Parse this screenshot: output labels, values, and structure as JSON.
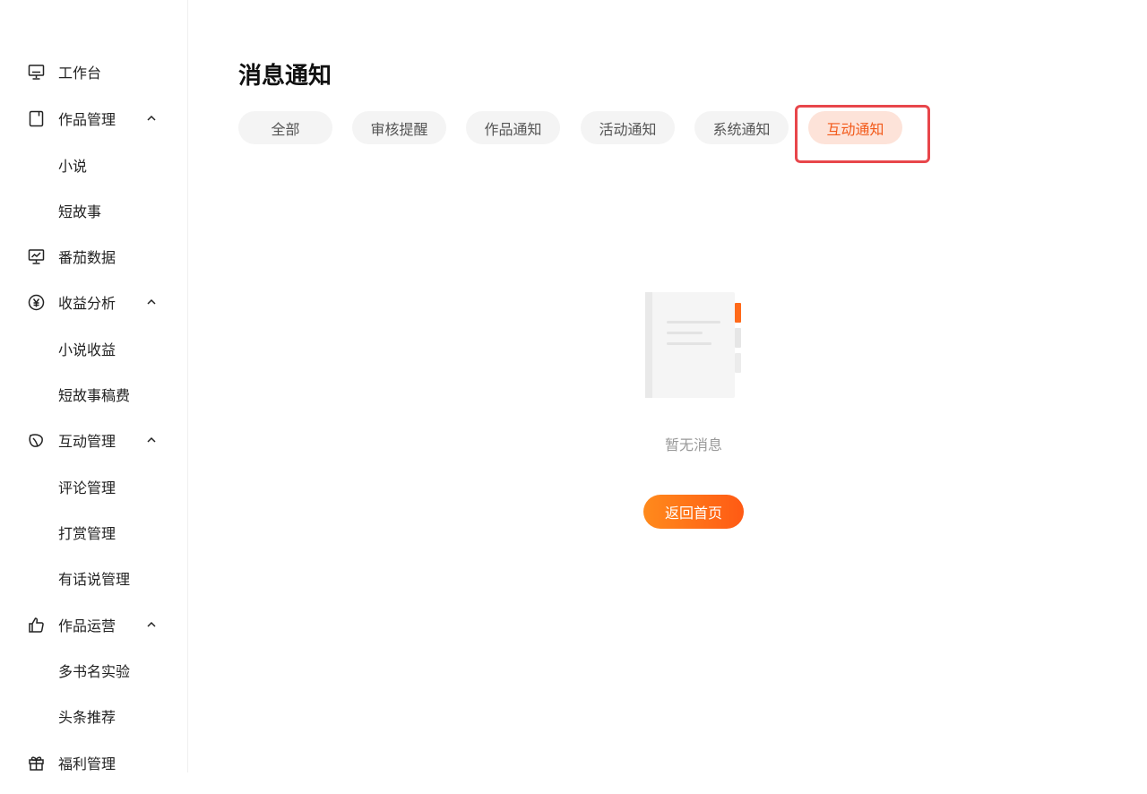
{
  "sidebar": {
    "items": [
      {
        "label": "工作台",
        "icon": "monitor-icon"
      },
      {
        "label": "作品管理",
        "icon": "book-icon",
        "expanded": true
      },
      {
        "label": "小说",
        "sub": true
      },
      {
        "label": "短故事",
        "sub": true
      },
      {
        "label": "番茄数据",
        "icon": "chart-monitor-icon"
      },
      {
        "label": "收益分析",
        "icon": "yen-circle-icon",
        "expanded": true
      },
      {
        "label": "小说收益",
        "sub": true
      },
      {
        "label": "短故事稿费",
        "sub": true
      },
      {
        "label": "互动管理",
        "icon": "leaf-icon",
        "expanded": true
      },
      {
        "label": "评论管理",
        "sub": true
      },
      {
        "label": "打赏管理",
        "sub": true
      },
      {
        "label": "有话说管理",
        "sub": true
      },
      {
        "label": "作品运营",
        "icon": "thumbs-up-icon",
        "expanded": true
      },
      {
        "label": "多书名实验",
        "sub": true
      },
      {
        "label": "头条推荐",
        "sub": true
      },
      {
        "label": "福利管理",
        "icon": "gift-icon"
      }
    ]
  },
  "main": {
    "title": "消息通知",
    "tabs": [
      {
        "label": "全部"
      },
      {
        "label": "审核提醒"
      },
      {
        "label": "作品通知"
      },
      {
        "label": "活动通知"
      },
      {
        "label": "系统通知"
      },
      {
        "label": "互动通知",
        "active": true
      }
    ],
    "empty_text": "暂无消息",
    "home_button": "返回首页"
  },
  "colors": {
    "accent": "#f25a1a",
    "active_tab_bg": "#fde3d9",
    "highlight": "#e8464b",
    "button_gradient_start": "#ff8a1c",
    "button_gradient_end": "#ff5a14"
  }
}
